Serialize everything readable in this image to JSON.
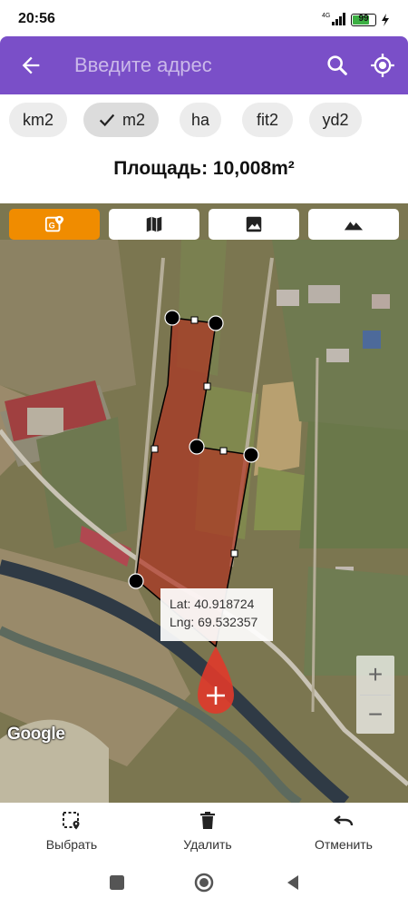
{
  "status": {
    "time": "20:56",
    "network": "4G",
    "battery": "99"
  },
  "search": {
    "placeholder": "Введите адрес"
  },
  "units": [
    {
      "label": "km2",
      "selected": false
    },
    {
      "label": "m2",
      "selected": true
    },
    {
      "label": "ha",
      "selected": false
    },
    {
      "label": "fit2",
      "selected": false
    },
    {
      "label": "yd2",
      "selected": false
    }
  ],
  "area": {
    "text": "Площадь: 10,008m²"
  },
  "map": {
    "types": [
      "hybrid-icon",
      "map-icon",
      "satellite-icon",
      "terrain-icon"
    ],
    "active_type": "hybrid-icon",
    "coords": {
      "lat": "Lat: 40.918724",
      "lng": "Lng: 69.532357"
    },
    "zoom_in": "+",
    "zoom_out": "−",
    "attribution": "Google",
    "polygon_color": "#b03020",
    "accent": "#f08c00"
  },
  "toolbar": {
    "select": "Выбрать",
    "delete": "Удалить",
    "undo": "Отменить"
  },
  "colors": {
    "app_bar": "#7a4fc8",
    "marker": "#e03a2a"
  }
}
